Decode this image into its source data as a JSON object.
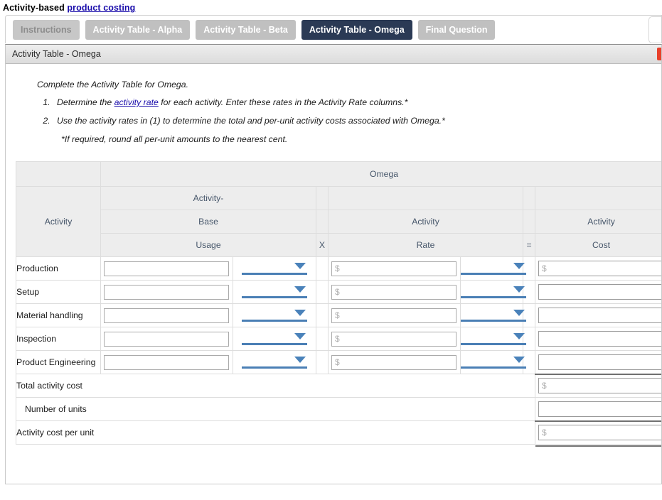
{
  "page": {
    "title_prefix": "Activity-based",
    "title_link": "product costing"
  },
  "tabs": [
    {
      "label": "Instructions",
      "state": "muted"
    },
    {
      "label": "Activity Table - Alpha",
      "state": "normal"
    },
    {
      "label": "Activity Table - Beta",
      "state": "normal"
    },
    {
      "label": "Activity Table - Omega",
      "state": "active"
    },
    {
      "label": "Final Question",
      "state": "normal"
    }
  ],
  "panel": {
    "header_title": "Activity Table - Omega"
  },
  "instructions": {
    "lead": "Complete the Activity Table for Omega.",
    "step1_before": "Determine the ",
    "step1_link": "activity rate",
    "step1_after": " for each activity. Enter these rates in the Activity Rate columns.*",
    "step2": "Use the activity rates in (1) to determine the total and per-unit activity costs associated with Omega.*",
    "footnote": "*If required, round all per-unit amounts to the nearest cent."
  },
  "table": {
    "product_group": "Omega",
    "col_activity": "Activity",
    "base_line1": "Activity-",
    "base_line2": "Base",
    "base_line3": "Usage",
    "op_times": "X",
    "op_equals": "=",
    "rate_line2": "Activity",
    "rate_line3": "Rate",
    "cost_line2": "Activity",
    "cost_line3": "Cost",
    "rows": [
      {
        "label": "Production",
        "usage_value": "",
        "usage_placeholder": "",
        "usage_unit_selected": "",
        "rate_value": "",
        "rate_placeholder": "$",
        "rate_unit_selected": "",
        "cost_value": "",
        "cost_placeholder": "$"
      },
      {
        "label": "Setup",
        "usage_value": "",
        "usage_placeholder": "",
        "usage_unit_selected": "",
        "rate_value": "",
        "rate_placeholder": "$",
        "rate_unit_selected": "",
        "cost_value": "",
        "cost_placeholder": ""
      },
      {
        "label": "Material handling",
        "usage_value": "",
        "usage_placeholder": "",
        "usage_unit_selected": "",
        "rate_value": "",
        "rate_placeholder": "$",
        "rate_unit_selected": "",
        "cost_value": "",
        "cost_placeholder": ""
      },
      {
        "label": "Inspection",
        "usage_value": "",
        "usage_placeholder": "",
        "usage_unit_selected": "",
        "rate_value": "",
        "rate_placeholder": "$",
        "rate_unit_selected": "",
        "cost_value": "",
        "cost_placeholder": ""
      },
      {
        "label": "Product Engineering",
        "usage_value": "",
        "usage_placeholder": "",
        "usage_unit_selected": "",
        "rate_value": "",
        "rate_placeholder": "$",
        "rate_unit_selected": "",
        "cost_value": "",
        "cost_placeholder": ""
      }
    ],
    "totals": [
      {
        "label": "Total activity cost",
        "value": "",
        "placeholder": "$"
      },
      {
        "label": "Number of units",
        "value": "",
        "placeholder": ""
      },
      {
        "label": "Activity cost per unit",
        "value": "",
        "placeholder": "$"
      }
    ]
  },
  "colors": {
    "tab_active_bg": "#2b3a55",
    "tab_bg": "#c0c0c0",
    "link": "#1a0dab",
    "dropdown_blue": "#4a82ba",
    "header_gray": "#ededed",
    "accent_red": "#e8402a"
  }
}
